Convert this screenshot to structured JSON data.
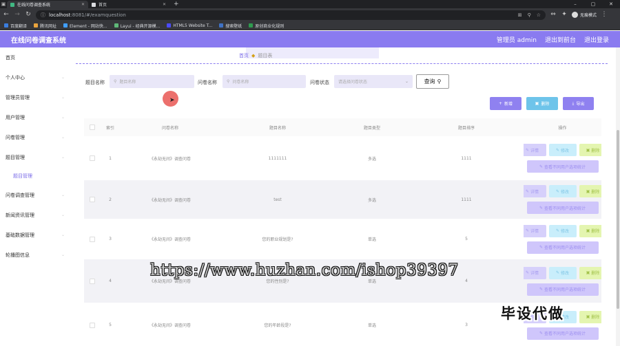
{
  "browser": {
    "tabs": [
      {
        "label": "在线问卷调查系统",
        "active": true,
        "favicon_color": "#41b883"
      },
      {
        "label": "首页",
        "active": false,
        "favicon_color": "#dadce0"
      }
    ],
    "new_tab": "+",
    "window_controls": [
      "–",
      "▢",
      "✕"
    ],
    "address": {
      "host": "localhost",
      "path": ":8081/#/examquestion"
    },
    "profile_label": "无痕模式",
    "bookmarks": [
      {
        "label": "百度翻译",
        "color": "#3b7ddd"
      },
      {
        "label": "腾讯网址",
        "color": "#e8a33d"
      },
      {
        "label": "Element - 网站快...",
        "color": "#409eff"
      },
      {
        "label": "Layui - 经典开源模...",
        "color": "#5fb878"
      },
      {
        "label": "HTML5 Website T...",
        "color": "#4b4bff"
      },
      {
        "label": "搜索壁纸",
        "color": "#3f72c5"
      },
      {
        "label": "原创商业化规则",
        "color": "#2e9b4e"
      }
    ]
  },
  "app": {
    "title": "在线问卷调查系统",
    "user_label": "管理员 admin",
    "back_label": "退出到前台",
    "logout_label": "退出登录",
    "accent": "#8a7bf0"
  },
  "sidebar": {
    "items": [
      {
        "label": "首页",
        "chevron": false
      },
      {
        "label": "个人中心",
        "chevron": true
      },
      {
        "label": "管理员管理",
        "chevron": true
      },
      {
        "label": "用户管理",
        "chevron": true
      },
      {
        "label": "问卷管理",
        "chevron": true
      },
      {
        "label": "题目管理",
        "chevron": true
      }
    ],
    "sub_item": "题目管理",
    "items_after": [
      {
        "label": "问卷调查管理",
        "chevron": true
      },
      {
        "label": "新闻资讯管理",
        "chevron": true
      },
      {
        "label": "基础数据管理",
        "chevron": true
      },
      {
        "label": "轮播图信息",
        "chevron": true
      }
    ]
  },
  "breadcrumb": {
    "home": "首页",
    "current": "题目表"
  },
  "filters": {
    "title_label": "题目名称",
    "title_placeholder": "题目名称",
    "exam_label": "问卷名称",
    "exam_placeholder": "问卷名称",
    "status_label": "问卷状态",
    "status_placeholder": "请选择问卷状态",
    "query_label": "查询"
  },
  "actions": {
    "add_label": "新增",
    "delete_label": "删除",
    "export_label": "导出"
  },
  "table": {
    "headers": [
      "索引",
      "问卷名称",
      "题目名称",
      "题目类型",
      "题目排序",
      "操作"
    ],
    "rows": [
      {
        "index": "1",
        "exam": "《永劫无间》调查问卷",
        "title": "1111111",
        "type": "多选",
        "order": "1111"
      },
      {
        "index": "2",
        "exam": "《永劫无间》调查问卷",
        "title": "test",
        "type": "多选",
        "order": "1111"
      },
      {
        "index": "3",
        "exam": "《永劫无间》调查问卷",
        "title": "您的职业规划是?",
        "type": "单选",
        "order": "5"
      },
      {
        "index": "4",
        "exam": "《永劫无间》调查问卷",
        "title": "您的性别是?",
        "type": "单选",
        "order": "4"
      },
      {
        "index": "5",
        "exam": "《永劫无间》调查问卷",
        "title": "您的年龄段是?",
        "type": "单选",
        "order": "3"
      }
    ],
    "op_view": "详情",
    "op_edit": "修改",
    "op_delete": "删除",
    "op_stats": "查看不同用户选项统计"
  },
  "overlays": {
    "watermark": "https://www.huzhan.com/ishop39397",
    "corner_banner": "毕设代做"
  }
}
